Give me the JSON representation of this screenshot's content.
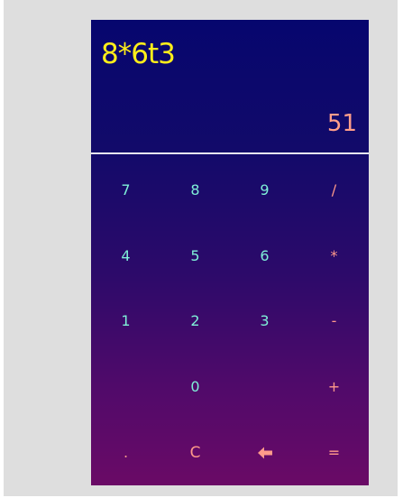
{
  "display": {
    "expression": "8*6t3",
    "result": "51"
  },
  "keys": {
    "k7": "7",
    "k8": "8",
    "k9": "9",
    "divide": "/",
    "k4": "4",
    "k5": "5",
    "k6": "6",
    "multiply": "*",
    "k1": "1",
    "k2": "2",
    "k3": "3",
    "minus": "-",
    "k0": "0",
    "plus": "+",
    "dot": ".",
    "clear": "C",
    "backspace_icon": "left-arrow-icon",
    "equals": "="
  },
  "colors": {
    "expression": "#ffee1a",
    "result": "#ff9e8a",
    "digits": "#7ff0d8",
    "operators": "#ff9a8a",
    "gradient_top": "#06066e",
    "gradient_bottom": "#6a0a66"
  }
}
